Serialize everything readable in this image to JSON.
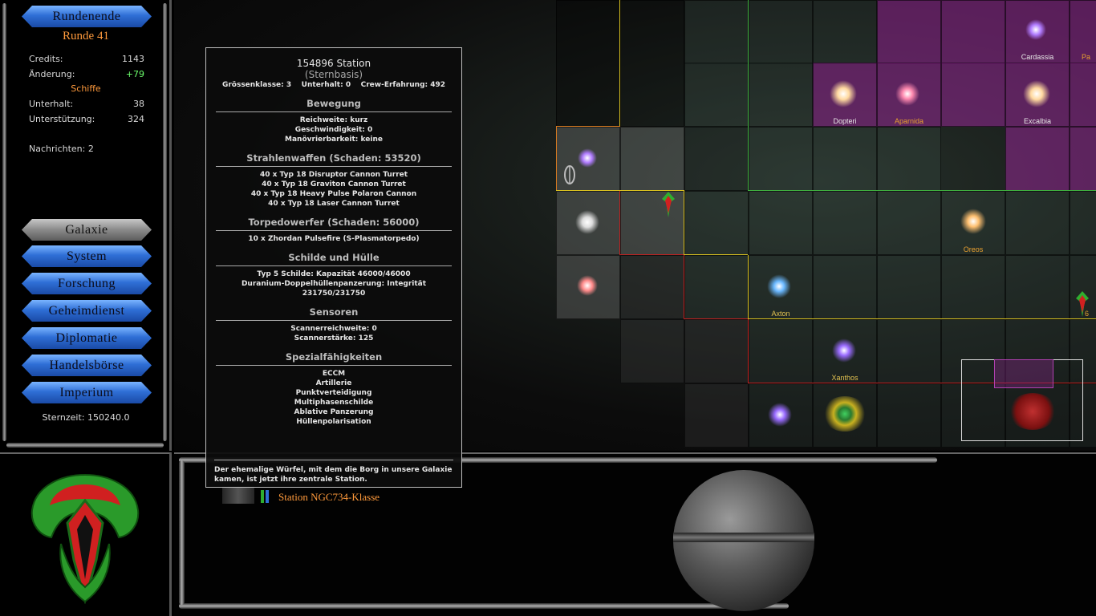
{
  "left_panel": {
    "end_turn_label": "Rundenende",
    "round_label": "Runde 41",
    "stats": {
      "credits_label": "Credits:",
      "credits_value": "1143",
      "change_label": "Änderung:",
      "change_value": "+79",
      "ships_label": "Schiffe",
      "upkeep_label": "Unterhalt:",
      "upkeep_value": "38",
      "support_label": "Unterstützung:",
      "support_value": "324",
      "news_label": "Nachrichten: 2"
    },
    "nav": [
      {
        "label": "Galaxie"
      },
      {
        "label": "System"
      },
      {
        "label": "Forschung"
      },
      {
        "label": "Geheimdienst"
      },
      {
        "label": "Diplomatie"
      },
      {
        "label": "Handelsbörse"
      },
      {
        "label": "Imperium"
      }
    ],
    "stardate": "Sternzeit: 150240.0"
  },
  "map": {
    "systems": [
      {
        "name": "Cardassia",
        "color": "#b07cff"
      },
      {
        "name": "Pa",
        "color": "#e8a030"
      },
      {
        "name": "Dopteri",
        "color": "#ffd9a0"
      },
      {
        "name": "Aparnida",
        "color": "#ff8ab0"
      },
      {
        "name": "Excalbia",
        "color": "#ffd9a0"
      },
      {
        "name": "Oreos",
        "color": "#ffc070"
      },
      {
        "name": "Axton",
        "color": "#6ab8ff"
      },
      {
        "name": "Xanthos",
        "color": "#9a6cff"
      },
      {
        "name": "6",
        "color": "#e8a030"
      }
    ]
  },
  "tooltip": {
    "title": "154896 Station",
    "subtitle": "(Sternbasis)",
    "summary": "Grössenklasse: 3    Unterhalt: 0    Crew-Erfahrung: 492",
    "movement_header": "Bewegung",
    "movement": [
      "Reichweite: kurz",
      "Geschwindigkeit: 0",
      "Manövrierbarkeit: keine"
    ],
    "beams_header": "Strahlenwaffen (Schaden: 53520)",
    "beams": [
      "40 x Typ 18 Disruptor Cannon Turret",
      "40 x Typ 18 Graviton Cannon Turret",
      "40 x Typ 18 Heavy Pulse Polaron Cannon",
      "40 x Typ 18 Laser Cannon Turret"
    ],
    "torpedo_header": "Torpedowerfer (Schaden: 56000)",
    "torpedoes": [
      "10 x Zhordan Pulsefire (S-Plasmatorpedo)"
    ],
    "shields_header": "Schilde und Hülle",
    "shields": [
      "Typ 5 Schilde: Kapazität 46000/46000",
      "Duranium-Doppelhüllenpanzerung: Integrität",
      "231750/231750"
    ],
    "sensors_header": "Sensoren",
    "sensors": [
      "Scannerreichweite: 0",
      "Scannerstärke: 125"
    ],
    "special_header": "Spezialfähigkeiten",
    "special": [
      "ECCM",
      "Artillerie",
      "Punktverteidigung",
      "Multiphasenschilde",
      "Ablative Panzerung",
      "Hüllenpolarisation"
    ],
    "description": "Der ehemalige Würfel, mit dem die Borg in unsere Galaxie kamen, ist jetzt ihre zentrale Station."
  },
  "bottom": {
    "ship_class": "Station NGC734-Klasse"
  },
  "colors": {
    "accent_orange": "#ff9a3c",
    "button_blue": "#2f6fd6",
    "border_yellow": "#d8c020",
    "border_red": "#c02020",
    "border_green": "#3fae3f",
    "border_orange": "#d87a20"
  }
}
